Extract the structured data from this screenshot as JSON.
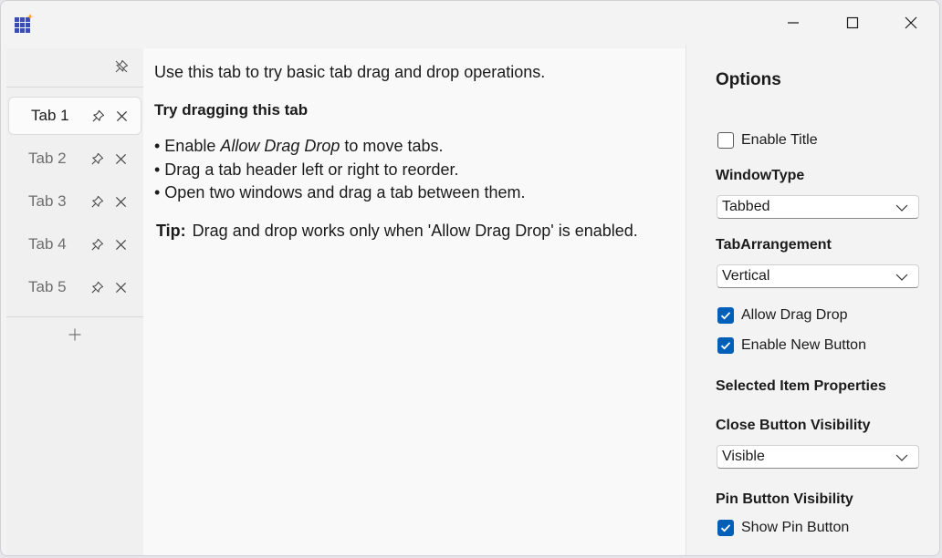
{
  "titlebar": {
    "icons": {
      "app": "app-grid-icon",
      "minimize": "minimize-icon",
      "maximize": "maximize-icon",
      "close": "close-icon"
    }
  },
  "tabstrip": {
    "pinned_toggle_icon": "unpin-icon",
    "tabs": [
      {
        "label": "Tab 1",
        "selected": true
      },
      {
        "label": "Tab 2",
        "selected": false
      },
      {
        "label": "Tab 3",
        "selected": false
      },
      {
        "label": "Tab 4",
        "selected": false
      },
      {
        "label": "Tab 5",
        "selected": false
      }
    ],
    "add_icon": "plus-icon"
  },
  "content": {
    "intro": "Use this tab to try basic tab drag and drop operations.",
    "heading": "Try dragging this tab",
    "bullet1_prefix": "• Enable ",
    "bullet1_emphasis": "Allow Drag Drop",
    "bullet1_suffix": " to move tabs.",
    "bullet2": "• Drag a tab header left or right to reorder.",
    "bullet3": "• Open two windows and drag a tab between them.",
    "tip_label": "Tip:",
    "tip_text": "Drag and drop works only when 'Allow Drag Drop' is enabled."
  },
  "options": {
    "title": "Options",
    "enable_title": {
      "label": "Enable Title",
      "checked": false
    },
    "window_type": {
      "label": "WindowType",
      "value": "Tabbed"
    },
    "tab_arrangement": {
      "label": "TabArrangement",
      "value": "Vertical"
    },
    "allow_drag_drop": {
      "label": "Allow Drag Drop",
      "checked": true
    },
    "enable_new_button": {
      "label": "Enable New Button",
      "checked": true
    },
    "selected_item_properties": "Selected Item Properties",
    "close_button_visibility": {
      "label": "Close Button Visibility",
      "value": "Visible"
    },
    "pin_button_visibility": {
      "label": "Pin Button Visibility"
    },
    "show_pin_button": {
      "label": "Show Pin Button",
      "checked": true
    }
  },
  "colors": {
    "accent": "#005fb8",
    "window_bg": "#f3f3f3",
    "content_bg": "#f9f9f9"
  }
}
